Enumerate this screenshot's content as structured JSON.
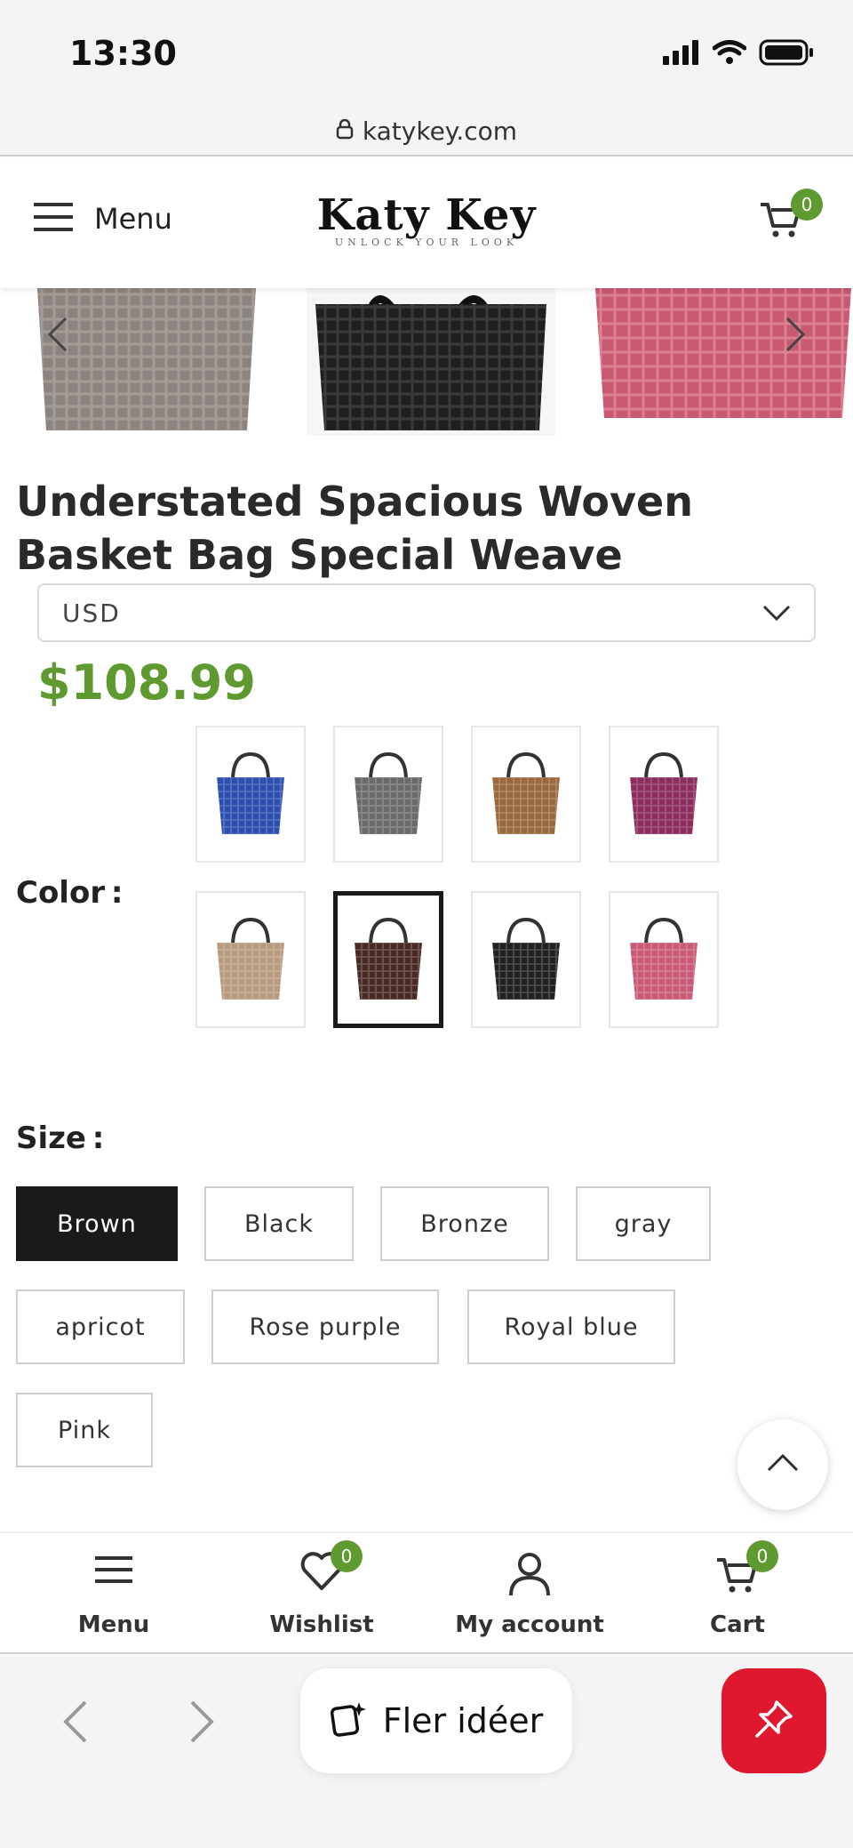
{
  "status_bar": {
    "time": "13:30"
  },
  "browser": {
    "url": "katykey.com"
  },
  "header": {
    "menu_label": "Menu",
    "logo": "Katy Key",
    "logo_tagline": "UNLOCK YOUR LOOK",
    "cart_count": "0"
  },
  "carousel": {
    "images": [
      "gray-woven-tote",
      "black-woven-tote",
      "pink-woven-tote"
    ],
    "image_colors": [
      "#8c8480",
      "#1f1f1f",
      "#c75a70"
    ]
  },
  "product": {
    "title": "Understated Spacious Woven Basket Bag Special Weave",
    "currency": "USD",
    "price": "$108.99"
  },
  "color": {
    "label": "Color :",
    "swatches": [
      {
        "name": "Royal blue",
        "hex": "#2d4fb0"
      },
      {
        "name": "gray",
        "hex": "#6a6a6a"
      },
      {
        "name": "Bronze",
        "hex": "#9a6a3e"
      },
      {
        "name": "Rose purple",
        "hex": "#8c2d5e"
      },
      {
        "name": "apricot",
        "hex": "#b89a7e"
      },
      {
        "name": "Brown",
        "hex": "#4a2a24",
        "selected": true
      },
      {
        "name": "Black",
        "hex": "#202020"
      },
      {
        "name": "Pink",
        "hex": "#c95b78"
      }
    ]
  },
  "size": {
    "label": "Size :",
    "options": [
      "Brown",
      "Black",
      "Bronze",
      "gray",
      "apricot",
      "Rose purple",
      "Royal blue",
      "Pink"
    ],
    "selected": "Brown"
  },
  "bottom_nav": {
    "menu": "Menu",
    "wishlist": "Wishlist",
    "wishlist_count": "0",
    "account": "My account",
    "cart": "Cart",
    "cart_count": "0"
  },
  "browser_toolbar": {
    "ideas_label": "Fler idéer"
  },
  "colors": {
    "accent_green": "#5e9a2f",
    "pin_red": "#e0182f"
  }
}
